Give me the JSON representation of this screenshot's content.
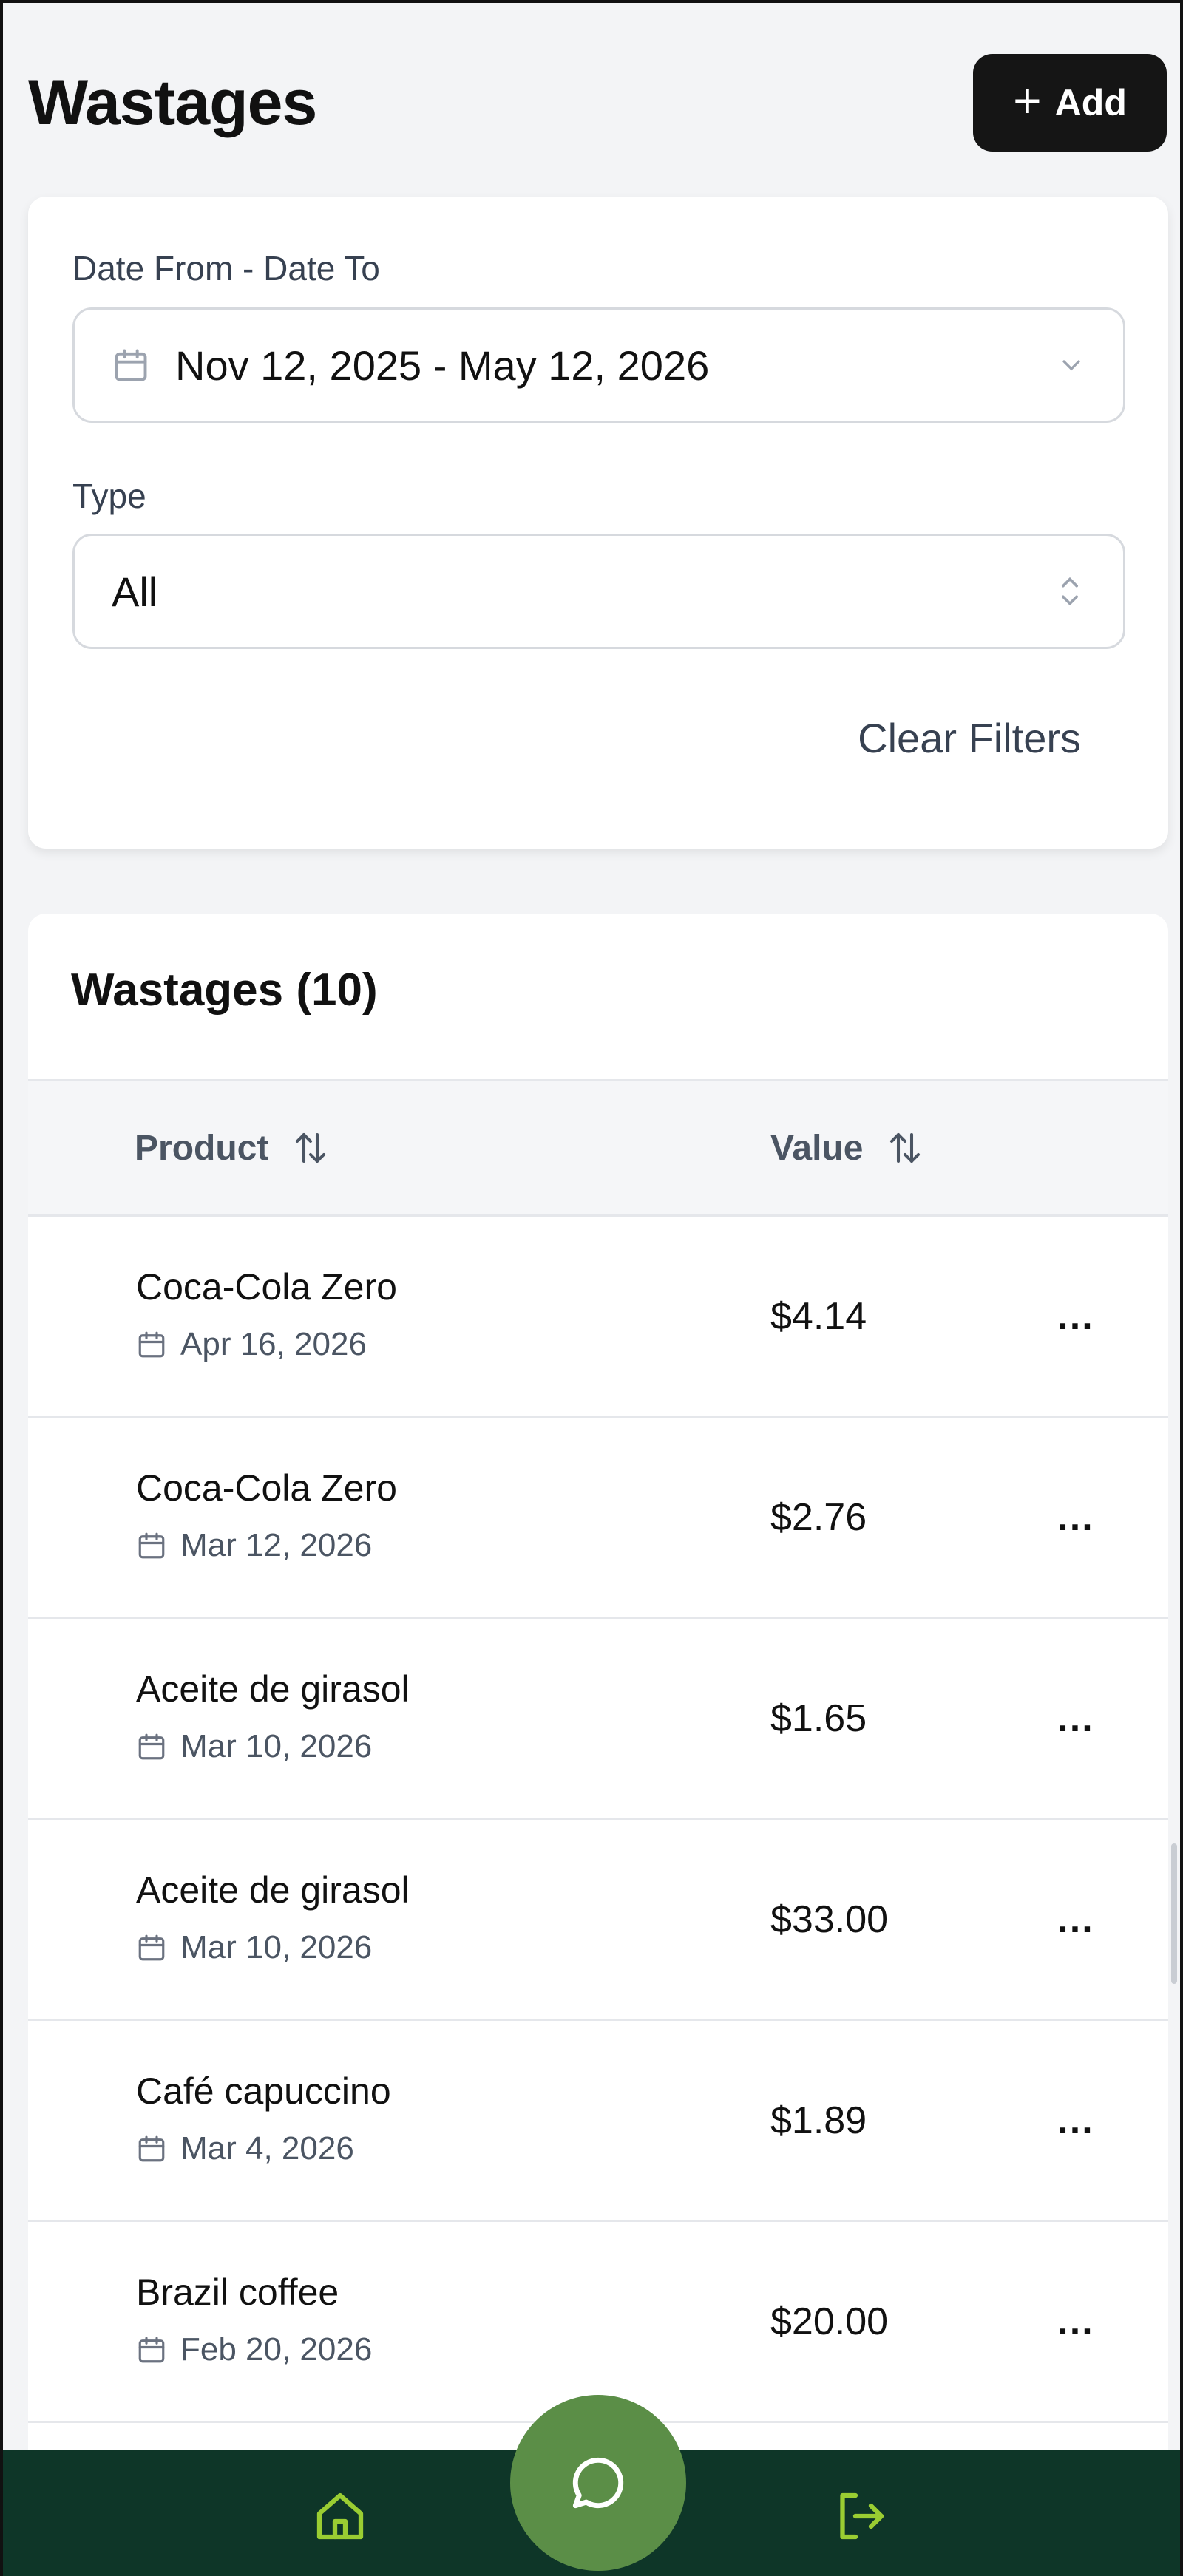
{
  "header": {
    "title": "Wastages",
    "add_label": "Add"
  },
  "filters": {
    "date_label": "Date From - Date To",
    "date_value": "Nov 12, 2025 - May 12, 2026",
    "type_label": "Type",
    "type_value": "All",
    "clear_label": "Clear Filters"
  },
  "table": {
    "title": "Wastages (10)",
    "columns": [
      "Product",
      "Value"
    ],
    "rows": [
      {
        "product": "Coca-Cola Zero",
        "date": "Apr 16, 2026",
        "value": "$4.14",
        "more": "…"
      },
      {
        "product": "Coca-Cola Zero",
        "date": "Mar 12, 2026",
        "value": "$2.76",
        "more": "…"
      },
      {
        "product": "Aceite de girasol",
        "date": "Mar 10, 2026",
        "value": "$1.65",
        "more": "…"
      },
      {
        "product": "Aceite de girasol",
        "date": "Mar 10, 2026",
        "value": "$33.00",
        "more": "…"
      },
      {
        "product": "Café capuccino",
        "date": "Mar 4, 2026",
        "value": "$1.89",
        "more": "…"
      },
      {
        "product": "Brazil coffee",
        "date": "Feb 20, 2026",
        "value": "$20.00",
        "more": "…"
      }
    ]
  },
  "nav": {
    "icons": [
      "home-icon",
      "chat-icon",
      "logout-icon"
    ]
  },
  "colors": {
    "nav_bg": "#0e3628",
    "accent": "#9acd32",
    "chat_button": "#5b8e47",
    "add_button": "#151515"
  }
}
